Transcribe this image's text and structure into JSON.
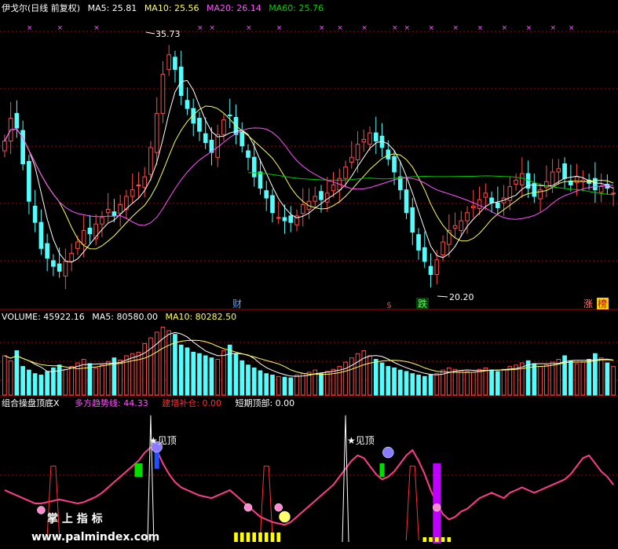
{
  "colors": {
    "background": "#000000",
    "up": "#ff4a4a",
    "down": "#54fcfc",
    "white": "#ffffff",
    "yellow": "#ffff54",
    "magenta": "#ff54ff",
    "green": "#00c800",
    "grid_red": "#b00000",
    "pink": "#ff3c8c"
  },
  "price_legend": {
    "title": "伊戈尔(日线 前复权)",
    "ma5": "MA5: 25.81",
    "ma10": "MA10: 25.56",
    "ma20": "MA20: 26.14",
    "ma60": "MA60: 25.76"
  },
  "volume_legend": {
    "title": "VOLUME: 45922.16",
    "ma5": "MA5: 80580.00",
    "ma10": "MA10: 80282.50"
  },
  "indicator_legend": {
    "title": "组合操盘顶底X",
    "trend": "多方趋势线: 44.33",
    "add": "建增补仓: 0.00",
    "top": "短期顶部: 0.00"
  },
  "annotations": {
    "high_label": "35.73",
    "low_label": "20.20",
    "tag_cai": "财",
    "tag_dollar": "$",
    "tag_die": "跌",
    "tag_zhang": "涨",
    "tag_bang": "榜",
    "top_mark_1": "★见顶",
    "top_mark_2": "★见顶",
    "x_marker": "×"
  },
  "watermark": {
    "line1": "掌 上 指 标",
    "line2": "www.palmindex.com"
  },
  "chart_data": [
    {
      "type": "candlestick",
      "title": "伊戈尔(日线 前复权)",
      "ylim": [
        19.5,
        37.5
      ],
      "high": 35.73,
      "low": 20.2,
      "close": [
        29.8,
        31.2,
        30.6,
        28.4,
        26.1,
        24.8,
        23.2,
        22.6,
        22.1,
        21.8,
        22.4,
        22.9,
        23.6,
        24.3,
        24.1,
        24.7,
        25.1,
        25.6,
        25.2,
        25.9,
        26.4,
        26.8,
        27.1,
        27.6,
        29.4,
        31.5,
        33.9,
        35.1,
        34.2,
        32.6,
        31.8,
        30.9,
        30.4,
        29.7,
        29.1,
        30.2,
        31.1,
        31.4,
        30.2,
        29.5,
        28.8,
        27.6,
        26.9,
        26.3,
        25.4,
        25.1,
        24.9,
        24.8,
        25.2,
        25.9,
        26.1,
        26.4,
        26.2,
        26.6,
        27.1,
        27.5,
        28.2,
        28.8,
        29.6,
        29.9,
        30.3,
        29.8,
        29.4,
        28.7,
        27.9,
        26.8,
        25.4,
        24.2,
        23.1,
        22.4,
        21.6,
        22.5,
        23.6,
        24.3,
        24.6,
        24.9,
        25.4,
        25.8,
        26.2,
        26.6,
        26.0,
        25.7,
        26.3,
        27.0,
        27.4,
        27.8,
        26.9,
        26.4,
        26.8,
        27.3,
        27.9,
        28.1,
        27.5,
        27.1,
        27.6,
        27.4,
        27.2,
        26.8,
        27.0,
        26.9,
        26.6
      ],
      "ma_series": [
        {
          "name": "MA5",
          "color": "#ffffff"
        },
        {
          "name": "MA10",
          "color": "#ffff54"
        },
        {
          "name": "MA20",
          "color": "#ff54ff"
        },
        {
          "name": "MA60",
          "color": "#00c800"
        }
      ]
    },
    {
      "type": "bar",
      "title": "VOLUME: 45922.16",
      "ylim": [
        0,
        100
      ],
      "values": [
        55,
        48,
        62,
        40,
        35,
        30,
        28,
        33,
        38,
        42,
        36,
        40,
        45,
        50,
        44,
        38,
        42,
        47,
        52,
        49,
        55,
        58,
        60,
        72,
        80,
        88,
        95,
        90,
        85,
        70,
        66,
        60,
        58,
        55,
        52,
        50,
        62,
        70,
        58,
        48,
        42,
        38,
        34,
        30,
        28,
        26,
        25,
        24,
        28,
        30,
        32,
        35,
        30,
        33,
        36,
        40,
        46,
        52,
        58,
        62,
        55,
        50,
        45,
        40,
        38,
        35,
        33,
        30,
        28,
        26,
        28,
        30,
        35,
        38,
        36,
        34,
        33,
        32,
        36,
        38,
        35,
        33,
        36,
        40,
        42,
        45,
        48,
        44,
        40,
        42,
        46,
        50,
        55,
        48,
        44,
        46,
        50,
        58,
        52,
        45,
        40
      ]
    },
    {
      "type": "line",
      "title": "组合操盘顶底X",
      "ylim": [
        0,
        100
      ],
      "trend_values": [
        40,
        38,
        36,
        34,
        32,
        30,
        30,
        31,
        32,
        33,
        32,
        31,
        30,
        31,
        33,
        35,
        38,
        42,
        46,
        50,
        54,
        58,
        62,
        68,
        72,
        70,
        60,
        52,
        46,
        42,
        40,
        38,
        36,
        35,
        34,
        36,
        38,
        40,
        36,
        32,
        28,
        24,
        20,
        18,
        16,
        15,
        14,
        16,
        20,
        24,
        28,
        32,
        36,
        40,
        44,
        50,
        56,
        62,
        66,
        64,
        58,
        52,
        48,
        50,
        54,
        60,
        66,
        70,
        62,
        52,
        40,
        30,
        22,
        18,
        20,
        24,
        26,
        30,
        34,
        36,
        38,
        36,
        34,
        38,
        40,
        42,
        40,
        38,
        40,
        42,
        44,
        46,
        48,
        52,
        58,
        64,
        66,
        60,
        54,
        50,
        44
      ]
    }
  ]
}
